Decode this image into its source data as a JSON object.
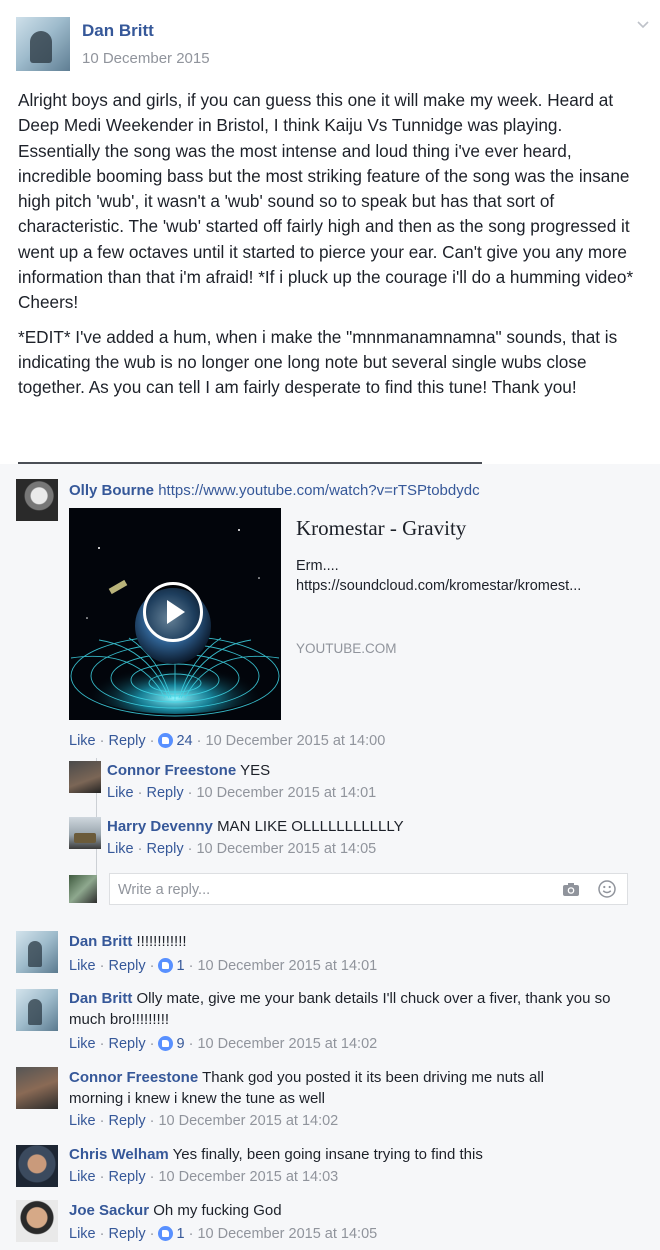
{
  "post": {
    "author": "Dan Britt",
    "date": "10 December 2015",
    "paragraphs": [
      "Alright boys and girls, if you can guess this one it will make my week. Heard at Deep Medi Weekender in Bristol, I think Kaiju Vs Tunnidge was playing. Essentially the song was the most intense and loud thing i've ever heard, incredible booming bass but the most striking feature of the song was the insane high pitch 'wub', it wasn't a 'wub' sound so to speak but has that sort of characteristic. The 'wub' started off fairly high and then as the song progressed it went up a few octaves until it started to pierce your ear. Can't give you any more information than that i'm afraid! *If i pluck up the courage i'll do a humming video*\nCheers!",
      "*EDIT* I've added a hum, when i make the \"mnnmanamnamna\" sounds, that is indicating the wub is no longer one long note but several single wubs close together. As you can tell I am fairly desperate to find this tune! Thank you!"
    ]
  },
  "comments": [
    {
      "author": "Olly Bourne",
      "text": "https://www.youtube.com/watch?v=rTSPtobdydc",
      "like": "Like",
      "reply": "Reply",
      "reactions": "24",
      "time": "10 December 2015 at 14:00",
      "preview": {
        "title": "Kromestar - Gravity",
        "desc_line1": "Erm....",
        "desc_line2": "https://soundcloud.com/kromestar/kromest...",
        "domain": "YOUTUBE.COM"
      },
      "replies": [
        {
          "author": "Connor Freestone",
          "text": "YES",
          "like": "Like",
          "reply": "Reply",
          "time": "10 December 2015 at 14:01"
        },
        {
          "author": "Harry Devenny",
          "text": "MAN LIKE OLLLLLLLLLLLY",
          "like": "Like",
          "reply": "Reply",
          "time": "10 December 2015 at 14:05"
        }
      ],
      "reply_placeholder": "Write a reply..."
    },
    {
      "author": "Dan Britt",
      "text": "!!!!!!!!!!!!",
      "like": "Like",
      "reply": "Reply",
      "reactions": "1",
      "time": "10 December 2015 at 14:01"
    },
    {
      "author": "Dan Britt",
      "text": "Olly mate, give me your bank details I'll chuck over a fiver, thank you so much bro!!!!!!!!!",
      "like": "Like",
      "reply": "Reply",
      "reactions": "9",
      "time": "10 December 2015 at 14:02"
    },
    {
      "author": "Connor Freestone",
      "text": "Thank god you posted it its been driving me nuts all morning i knew i knew the tune as well",
      "like": "Like",
      "reply": "Reply",
      "time": "10 December 2015 at 14:02"
    },
    {
      "author": "Chris Welham",
      "text": "Yes finally, been going insane trying to find this",
      "like": "Like",
      "reply": "Reply",
      "time": "10 December 2015 at 14:03"
    },
    {
      "author": "Joe Sackur",
      "text": "Oh my fucking God",
      "like": "Like",
      "reply": "Reply",
      "reactions": "1",
      "time": "10 December 2015 at 14:05"
    }
  ],
  "meta_separator": " · ",
  "colors": {
    "link": "#365899",
    "meta": "#90949c",
    "reaction": "#5890ff",
    "comments_bg": "#f6f7f9"
  },
  "icons": {
    "chevron": "chevron-down-icon",
    "camera": "camera-icon",
    "emoji": "emoji-icon",
    "play": "play-icon",
    "like": "like-reaction-icon"
  }
}
